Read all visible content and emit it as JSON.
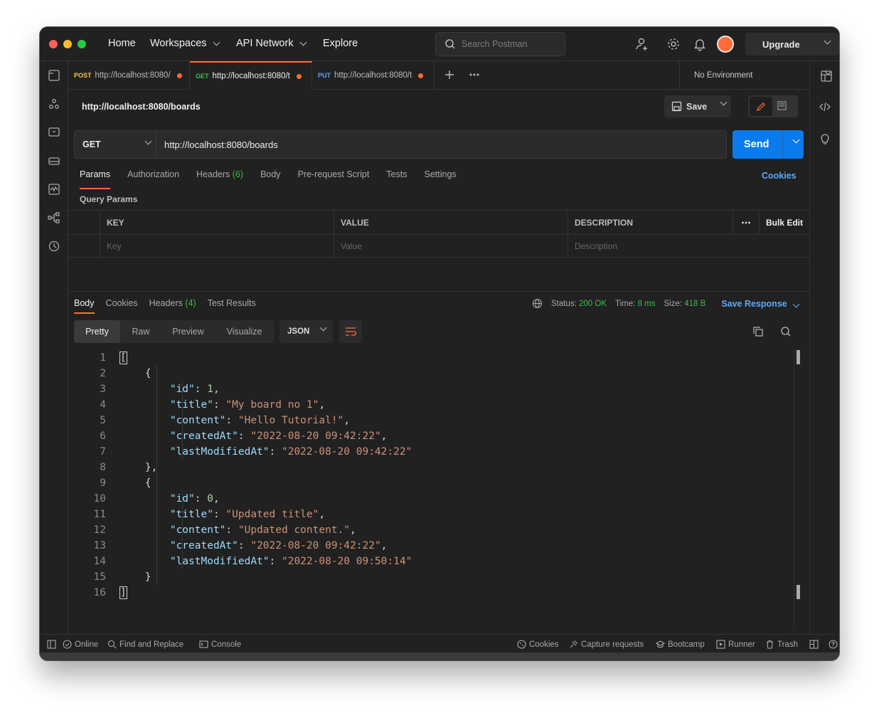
{
  "titlebar": {
    "nav": [
      "Home",
      "Workspaces",
      "API Network",
      "Explore"
    ],
    "search_placeholder": "Search Postman",
    "upgrade_label": "Upgrade"
  },
  "tabs": [
    {
      "method": "POST",
      "url": "http://localhost:8080/",
      "method_color": "#f2c94c"
    },
    {
      "method": "GET",
      "url": "http://localhost:8080/t",
      "method_color": "#3fb950"
    },
    {
      "method": "PUT",
      "url": "http://localhost:8080/t",
      "method_color": "#5ca8f8"
    }
  ],
  "environment": "No Environment",
  "request": {
    "title": "http://localhost:8080/boards",
    "save_label": "Save",
    "method": "GET",
    "url": "http://localhost:8080/boards",
    "send_label": "Send"
  },
  "request_tabs": {
    "params": "Params",
    "authorization": "Authorization",
    "headers": "Headers",
    "headers_count": "(6)",
    "body": "Body",
    "prerequest": "Pre-request Script",
    "tests": "Tests",
    "settings": "Settings",
    "cookies": "Cookies"
  },
  "query_params": {
    "label": "Query Params",
    "col_key": "KEY",
    "col_value": "VALUE",
    "col_description": "DESCRIPTION",
    "bulk_edit": "Bulk Edit",
    "ph_key": "Key",
    "ph_value": "Value",
    "ph_description": "Description"
  },
  "response": {
    "tabs": {
      "body": "Body",
      "cookies": "Cookies",
      "headers": "Headers",
      "headers_count": "(4)",
      "tests": "Test Results"
    },
    "status_label": "Status:",
    "status_value": "200 OK",
    "time_label": "Time:",
    "time_value": "8 ms",
    "size_label": "Size:",
    "size_value": "418 B",
    "save_response": "Save Response",
    "views": [
      "Pretty",
      "Raw",
      "Preview",
      "Visualize"
    ],
    "format": "JSON"
  },
  "code_lines": [
    "1",
    "2",
    "3",
    "4",
    "5",
    "6",
    "7",
    "8",
    "9",
    "10",
    "11",
    "12",
    "13",
    "14",
    "15",
    "16"
  ],
  "records": [
    {
      "id": "1",
      "title": "\"My board no 1\"",
      "content": "\"Hello Tutorial!\"",
      "createdAt": "\"2022-08-20 09:42:22\"",
      "lastModifiedAt": "\"2022-08-20 09:42:22\""
    },
    {
      "id": "0",
      "title": "\"Updated title\"",
      "content": "\"Updated content.\"",
      "createdAt": "\"2022-08-20 09:42:22\"",
      "lastModifiedAt": "\"2022-08-20 09:50:14\""
    }
  ],
  "statusbar": {
    "online": "Online",
    "find_replace": "Find and Replace",
    "console": "Console",
    "cookies": "Cookies",
    "capture": "Capture requests",
    "bootcamp": "Bootcamp",
    "runner": "Runner",
    "trash": "Trash"
  }
}
